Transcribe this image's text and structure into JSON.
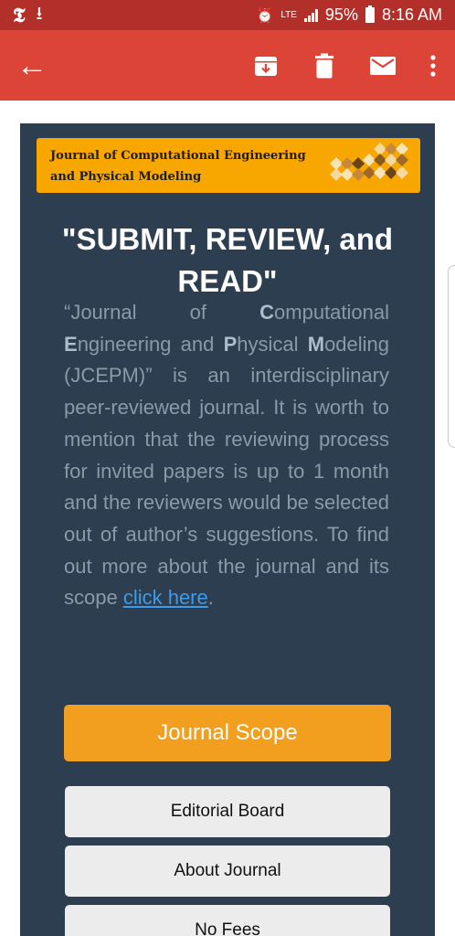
{
  "status_bar": {
    "nyt_icon": "𝕿",
    "download_icon": "⭳",
    "network": "LTE",
    "battery": "95%",
    "time": "8:16 AM"
  },
  "app_bar": {
    "back_icon": "←",
    "actions": [
      "archive-icon",
      "delete-icon",
      "mark-unread-icon",
      "more-options-icon"
    ]
  },
  "email": {
    "banner_line1": "Journal of Computational Engineering",
    "banner_line2": "and Physical Modeling",
    "headline": "\"SUBMIT, REVIEW, and READ\"",
    "body": {
      "p1": "“Journal of ",
      "C": "C",
      "p2": "omputational ",
      "E": "E",
      "p3": "ngineering and ",
      "P": "P",
      "p4": "hysical ",
      "M": "M",
      "p5": "odeling (JCEPM)” is an interdisciplinary peer-reviewed journal. It is worth to mention that the reviewing process for invited papers is up to 1 month and the reviewers would be selected out of author’s suggestions. To find out more about the journal and its scope ",
      "link": "click here",
      "end": "."
    },
    "scope_button": "Journal Scope",
    "buttons": [
      "Editorial Board",
      "About Journal",
      "No Fees"
    ]
  },
  "colors": {
    "status_bar": "#b3302a",
    "app_bar": "#dc4437",
    "card": "#2c3e50",
    "banner": "#f7a700",
    "scope_button": "#f29e1f",
    "link": "#3d9be9"
  }
}
